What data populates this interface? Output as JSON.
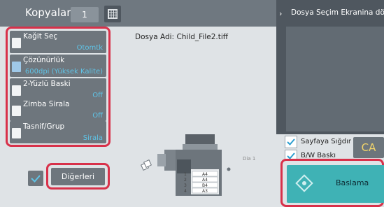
{
  "header": {
    "title": "Kopyalar",
    "copies": "1"
  },
  "settings": [
    {
      "label": "Kağit Seç",
      "value": "Otomtk",
      "icon": "paper-select-icon"
    },
    {
      "label": "Çözünürlük",
      "value": "600dpi (Yüksek Kalite)",
      "icon": "resolution-icon"
    },
    {
      "label": "2-Yüzlü Baski",
      "value": "Off",
      "icon": "duplex-icon"
    },
    {
      "label": "Zimba Sirala",
      "value": "Off",
      "icon": "staple-sort-icon"
    },
    {
      "label": "Tasnif/Grup",
      "value": "Sirala",
      "icon": "sort-group-icon"
    }
  ],
  "file": {
    "label": "Dosya Adi:",
    "name": "Child_File2.tiff"
  },
  "machine": {
    "trays": [
      "A4",
      "A4",
      "B4",
      "A3"
    ],
    "page": "Dia 1"
  },
  "right_panel": {
    "title": "Dosya Seçim Ekranina dön"
  },
  "options": {
    "fit_page": "Sayfaya Sığdır",
    "bw_print": "B/W Baskı"
  },
  "buttons": {
    "ca": "CA",
    "start": "Baslama",
    "others": "Diğerleri"
  },
  "colors": {
    "highlight": "#d8314a",
    "start_button": "#3fb2b5",
    "setting_value": "#5fc3e6"
  }
}
